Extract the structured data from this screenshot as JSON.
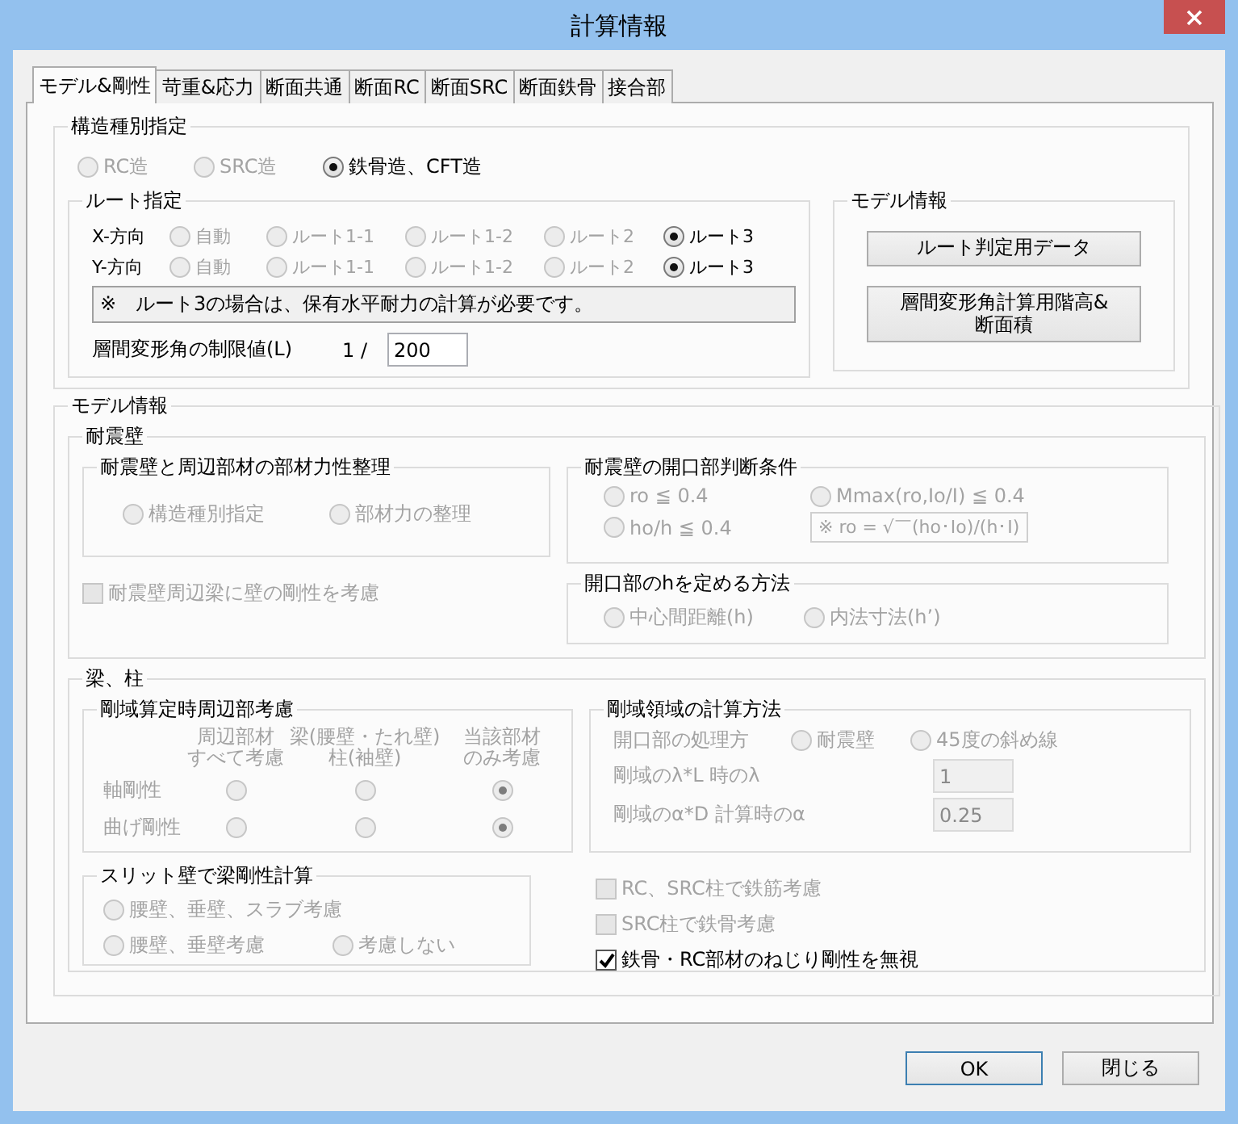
{
  "window": {
    "title": "計算情報"
  },
  "tabs": [
    {
      "label": "モデル&剛性",
      "selected": true
    },
    {
      "label": "苛重&応力",
      "selected": false
    },
    {
      "label": "断面共通",
      "selected": false
    },
    {
      "label": "断面RC",
      "selected": false
    },
    {
      "label": "断面SRC",
      "selected": false
    },
    {
      "label": "断面鉄骨",
      "selected": false
    },
    {
      "label": "接合部",
      "selected": false
    }
  ],
  "structure_type": {
    "title": "構造種別指定",
    "options": [
      {
        "label": "RC造",
        "selected": false,
        "disabled": true
      },
      {
        "label": "SRC造",
        "selected": false,
        "disabled": true
      },
      {
        "label": "鉄骨造、CFT造",
        "selected": true,
        "disabled": false
      }
    ]
  },
  "route": {
    "title": "ルート指定",
    "rows": [
      {
        "label": "X-方向",
        "options": [
          {
            "label": "自動",
            "selected": false,
            "disabled": true
          },
          {
            "label": "ルート1-1",
            "selected": false,
            "disabled": true
          },
          {
            "label": "ルート1-2",
            "selected": false,
            "disabled": true
          },
          {
            "label": "ルート2",
            "selected": false,
            "disabled": true
          },
          {
            "label": "ルート3",
            "selected": true,
            "disabled": false
          }
        ]
      },
      {
        "label": "Y-方向",
        "options": [
          {
            "label": "自動",
            "selected": false,
            "disabled": true
          },
          {
            "label": "ルート1-1",
            "selected": false,
            "disabled": true
          },
          {
            "label": "ルート1-2",
            "selected": false,
            "disabled": true
          },
          {
            "label": "ルート2",
            "selected": false,
            "disabled": true
          },
          {
            "label": "ルート3",
            "selected": true,
            "disabled": false
          }
        ]
      }
    ],
    "note": "※　ルート3の場合は、保有水平耐力の計算が必要です。",
    "drift_label": "層間変形角の制限値(L)",
    "drift_prefix": "1 /",
    "drift_value": "200"
  },
  "model_side": {
    "title": "モデル情報",
    "buttons": [
      "ルート判定用データ",
      "層間変形角計算用階高&\n断面積"
    ]
  },
  "model_info": {
    "title": "モデル情報",
    "shear_wall": {
      "title": "耐震壁",
      "member_force": {
        "title": "耐震壁と周辺部材の部材力性整理",
        "options": [
          {
            "label": "構造種別指定",
            "selected": false,
            "disabled": true
          },
          {
            "label": "部材力の整理",
            "selected": false,
            "disabled": true
          }
        ]
      },
      "wall_stiffness": {
        "label": "耐震壁周辺梁に壁の剛性を考慮",
        "checked": false,
        "disabled": true
      },
      "opening": {
        "title": "耐震壁の開口部判断条件",
        "options": [
          {
            "label": "ro ≦ 0.4",
            "selected": false,
            "disabled": true
          },
          {
            "label": "Mmax(ro,Io/I) ≦ 0.4",
            "selected": false,
            "disabled": true
          },
          {
            "label": "ho/h ≦ 0.4",
            "selected": false,
            "disabled": true
          }
        ],
        "formula": "※ ro = √￣(ho･Io)/(h･I)"
      },
      "opening_h": {
        "title": "開口部のhを定める方法",
        "options": [
          {
            "label": "中心間距離(h)",
            "selected": false,
            "disabled": true
          },
          {
            "label": "内法寸法(h’)",
            "selected": false,
            "disabled": true
          }
        ]
      }
    },
    "beam_column": {
      "title": "梁、柱",
      "rigid_consider": {
        "title": "剛域算定時周辺部考慮",
        "columns": [
          {
            "lines": [
              "周辺部材",
              "すべて考慮"
            ]
          },
          {
            "lines": [
              "梁(腰壁・たれ壁)",
              "柱(袖壁)"
            ]
          },
          {
            "lines": [
              "当該部材",
              "のみ考慮"
            ]
          }
        ],
        "rows": [
          {
            "label": "軸剛性",
            "options": [
              {
                "selected": false,
                "disabled": true
              },
              {
                "selected": false,
                "disabled": true
              },
              {
                "selected": true,
                "disabled": true
              }
            ]
          },
          {
            "label": "曲げ剛性",
            "options": [
              {
                "selected": false,
                "disabled": true
              },
              {
                "selected": false,
                "disabled": true
              },
              {
                "selected": true,
                "disabled": true
              }
            ]
          }
        ]
      },
      "slit_wall": {
        "title": "スリット壁で梁剛性計算",
        "options": [
          {
            "label": "腰壁、垂壁、スラブ考慮",
            "selected": false,
            "disabled": true
          },
          {
            "label": "腰壁、垂壁考慮",
            "selected": false,
            "disabled": true
          },
          {
            "label": "考慮しない",
            "selected": false,
            "disabled": true
          }
        ]
      },
      "rigid_method": {
        "title": "剛域領域の計算方法",
        "opening_label": "開口部の処理方",
        "options": [
          {
            "label": "耐震壁",
            "selected": false,
            "disabled": true
          },
          {
            "label": "45度の斜め線",
            "selected": false,
            "disabled": true
          }
        ],
        "fields": [
          {
            "label": "剛域のλ*L 時のλ",
            "value": "1"
          },
          {
            "label": "剛域のα*D 計算時のα",
            "value": "0.25"
          }
        ]
      },
      "checkboxes": [
        {
          "label": "RC、SRC柱で鉄筋考慮",
          "checked": false,
          "disabled": true
        },
        {
          "label": "SRC柱で鉄骨考慮",
          "checked": false,
          "disabled": true
        },
        {
          "label": "鉄骨・RC部材のねじり剛性を無視",
          "checked": true,
          "disabled": false
        }
      ]
    }
  },
  "buttons": [
    {
      "label": "OK",
      "default": true
    },
    {
      "label": "閉じる",
      "default": false
    }
  ]
}
